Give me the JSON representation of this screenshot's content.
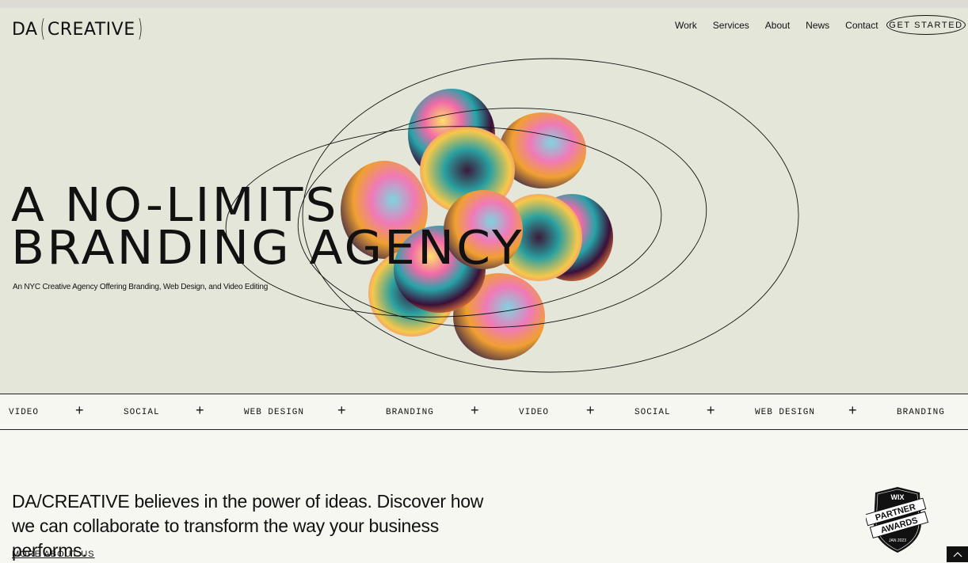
{
  "brand": {
    "logo_left": "DA",
    "logo_right": "CREATIVE"
  },
  "nav": [
    "Work",
    "Services",
    "About",
    "News",
    "Contact"
  ],
  "cta_label": "GET STARTED",
  "hero": {
    "title_line1": "A NO-LIMITS",
    "title_line2": "BRANDING AGENCY",
    "subtitle": "An NYC Creative Agency Offering Branding, Web Design, and Video Editing"
  },
  "ticker": [
    "VIDEO",
    "SOCIAL",
    "WEB DESIGN",
    "BRANDING",
    "VIDEO",
    "SOCIAL",
    "WEB DESIGN",
    "BRANDING"
  ],
  "ticker_separator": "+",
  "about": {
    "text": "DA/CREATIVE believes in the power of ideas. Discover how we can collaborate to transform the way your business performs.",
    "link": "MORE ABOUT US"
  },
  "badge": {
    "top": "WIX",
    "line1": "PARTNER",
    "line2": "AWARDS",
    "date": "JAN 2023"
  },
  "colors": {
    "hero_bg": "#e5e6da",
    "page_bg": "#f7f7f2",
    "ink": "#111111"
  },
  "icons": {
    "scroll_top": "chevron-up-icon"
  }
}
